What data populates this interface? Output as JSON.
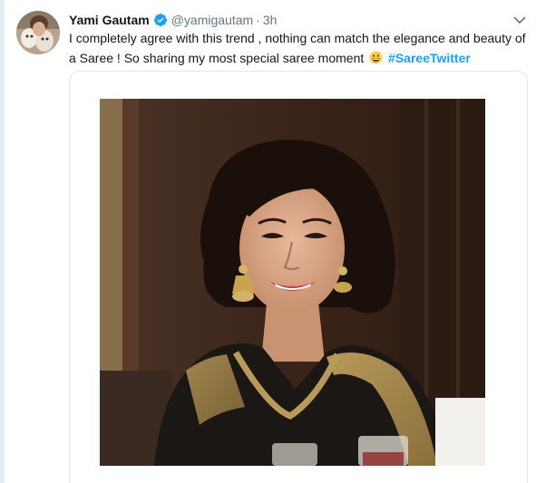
{
  "tweet": {
    "author": {
      "display_name": "Yami Gautam",
      "handle": "@yamigautam",
      "verified": true
    },
    "separator": "·",
    "timestamp": "3h",
    "text_before_emoji": "I completely agree with this trend , nothing can match the elegance and beauty of a Saree ! So sharing my  most special saree moment",
    "emoji": "grinning-face",
    "hashtag": "#SareeTwitter",
    "media": {
      "type": "photo",
      "subject": "woman-in-black-saree"
    }
  },
  "colors": {
    "accent": "#1da1f2",
    "text": "#14171a",
    "secondary_text": "#657786",
    "card_border": "#e1e8ed"
  },
  "icons": [
    "verified-badge-icon",
    "chevron-down-icon",
    "grinning-emoji-icon"
  ]
}
